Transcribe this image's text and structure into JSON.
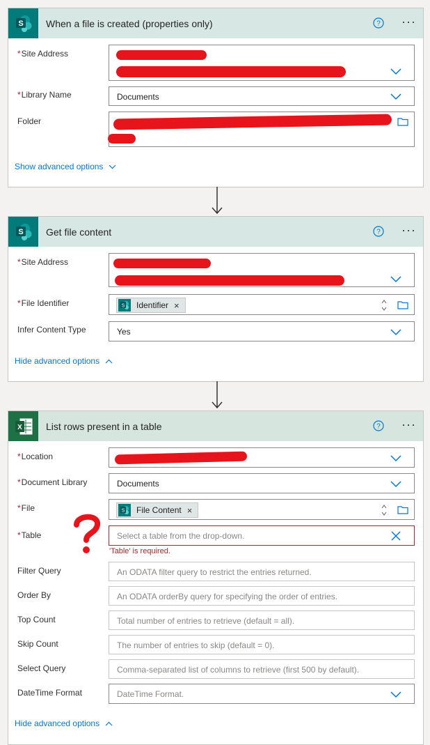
{
  "flow": {
    "trigger": {
      "title": "When a file is created (properties only)",
      "app_icon": "sharepoint-icon",
      "site_address_label": "Site Address",
      "library_name_label": "Library Name",
      "library_name_value": "Documents",
      "folder_label": "Folder",
      "advanced_link": "Show advanced options"
    },
    "get_content": {
      "title": "Get file content",
      "app_icon": "sharepoint-icon",
      "site_address_label": "Site Address",
      "file_identifier_label": "File Identifier",
      "file_identifier_token": "Identifier",
      "infer_label": "Infer Content Type",
      "infer_value": "Yes",
      "advanced_link": "Hide advanced options"
    },
    "list_rows": {
      "title": "List rows present in a table",
      "app_icon": "excel-icon",
      "location_label": "Location",
      "doc_library_label": "Document Library",
      "doc_library_value": "Documents",
      "file_label": "File",
      "file_token": "File Content",
      "table_label": "Table",
      "table_placeholder": "Select a table from the drop-down.",
      "table_error": "'Table' is required.",
      "filter_label": "Filter Query",
      "filter_placeholder": "An ODATA filter query to restrict the entries returned.",
      "order_label": "Order By",
      "order_placeholder": "An ODATA orderBy query for specifying the order of entries.",
      "top_label": "Top Count",
      "top_placeholder": "Total number of entries to retrieve (default = all).",
      "skip_label": "Skip Count",
      "skip_placeholder": "The number of entries to skip (default = 0).",
      "select_label": "Select Query",
      "select_placeholder": "Comma-separated list of columns to retrieve (first 500 by default).",
      "datetime_label": "DateTime Format",
      "datetime_placeholder": "DateTime Format.",
      "advanced_link": "Hide advanced options"
    },
    "required_mark": "*",
    "token_remove": "×",
    "more_menu": "···"
  },
  "colors": {
    "sharepoint": "#037b7b",
    "excel": "#1e7145",
    "link": "#0078d4",
    "error": "#a4262c",
    "redaction": "#e8141c"
  }
}
